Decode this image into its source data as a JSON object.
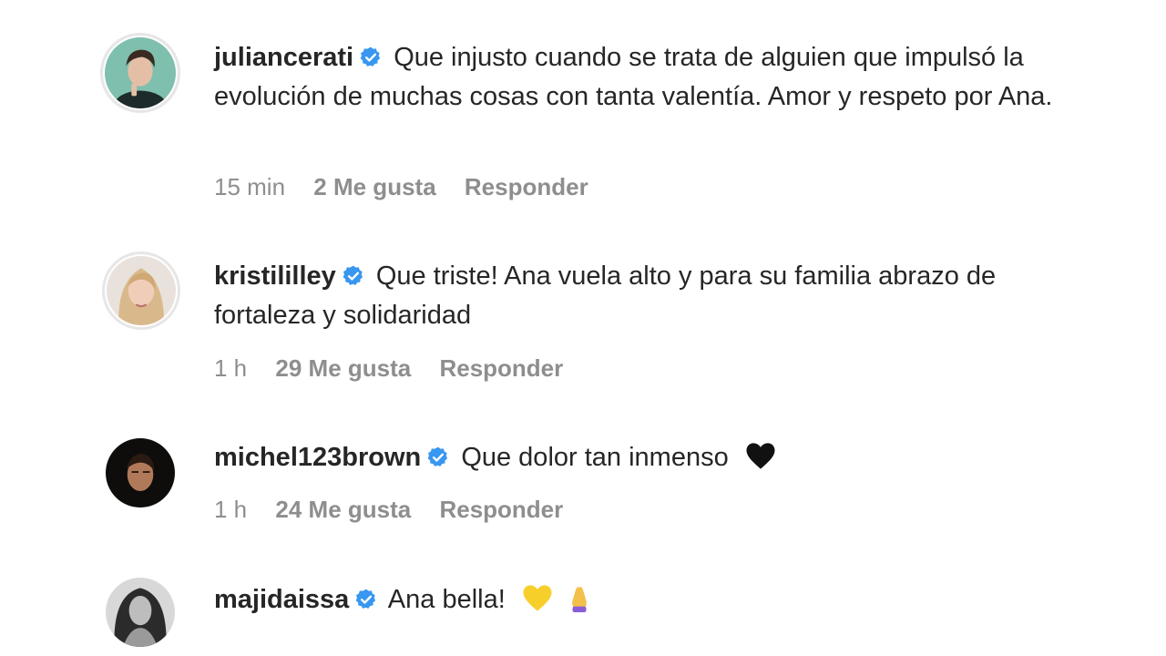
{
  "colors": {
    "text": "#262626",
    "muted": "#8e8e8e",
    "verified": "#3897f0"
  },
  "comments": [
    {
      "username": "juliancerati",
      "text": "Que injusto cuando se trata de alguien que impulsó la evolución de muchas cosas con tanta valentía. Amor y respeto por Ana.",
      "time": "15 min",
      "likes": "2 Me gusta",
      "reply": "Responder"
    },
    {
      "username": "kristililley",
      "text": "Que triste! Ana vuela alto y para su familia abrazo de fortaleza y solidaridad",
      "time": "1 h",
      "likes": "29 Me gusta",
      "reply": "Responder"
    },
    {
      "username": "michel123brown",
      "text": "Que dolor tan inmenso",
      "emoji": "black-heart-icon",
      "time": "1 h",
      "likes": "24 Me gusta",
      "reply": "Responder"
    },
    {
      "username": "majidaissa",
      "text": "Ana bella!",
      "emoji": "yellow-heart-and-praying-hands-icons"
    }
  ]
}
